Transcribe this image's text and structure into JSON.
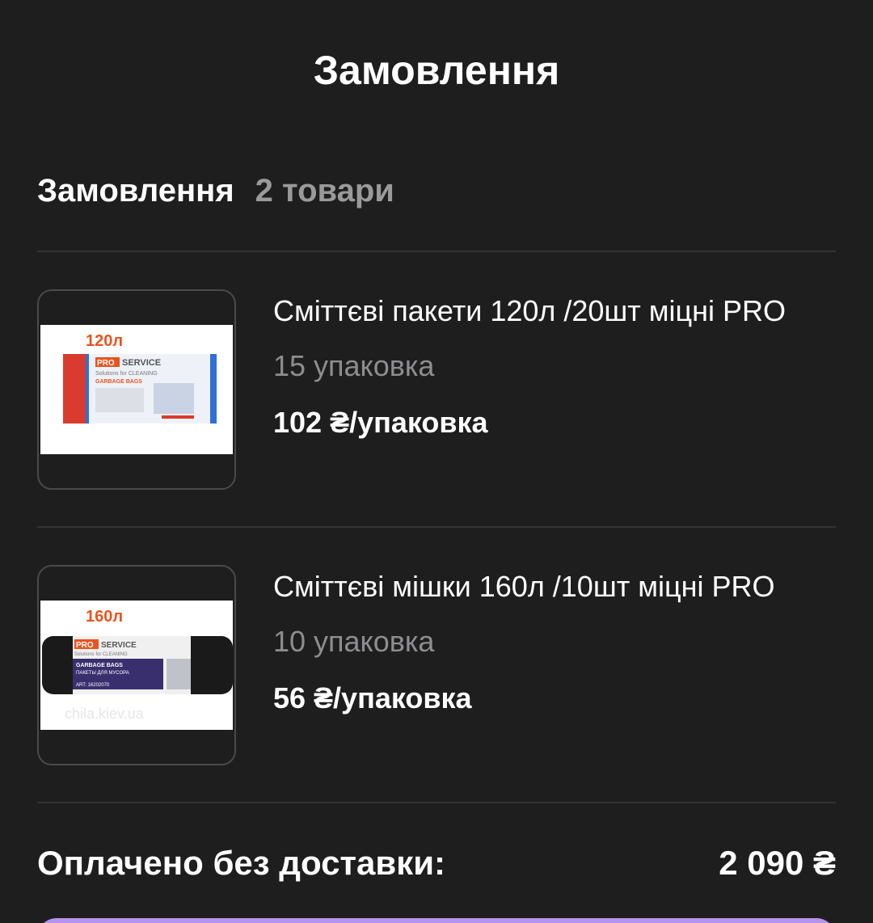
{
  "header": {
    "title": "Замовлення"
  },
  "order": {
    "section_title": "Замовлення",
    "count_label": "2 товари",
    "items": [
      {
        "name": "Сміттєві пакети 120л /20шт міцні PRO",
        "quantity": "15 упаковка",
        "price": "102 ₴/упаковка",
        "image": {
          "volume": "120л",
          "brand_pro": "PRO",
          "brand_service": "SERVICE",
          "tagline": "Solutions for CLEANING",
          "type": "GARBAGE BAGS",
          "roll_color": "#2f6fd6"
        }
      },
      {
        "name": "Сміттєві мішки 160л /10шт міцні PRO",
        "quantity": "10 упаковка",
        "price": "56 ₴/упаковка",
        "image": {
          "volume": "160л",
          "brand_pro": "PRO",
          "brand_service": "SERVICE",
          "tagline": "Solutions for CLEANING",
          "type": "GARBAGE BAGS",
          "subtype": "ПАКЕТЫ ДЛЯ МУСОРА",
          "art": "ART: 16202070",
          "watermark": "chila.kiev.ua",
          "roll_color": "#1a1a1a"
        }
      }
    ]
  },
  "summary": {
    "total_label": "Оплачено без доставки:",
    "total_value": "2 090 ₴"
  },
  "colors": {
    "background": "#1f1e1f",
    "muted_text": "#8e8d8f",
    "accent": "#b793f0",
    "brand_orange": "#e8541e"
  }
}
